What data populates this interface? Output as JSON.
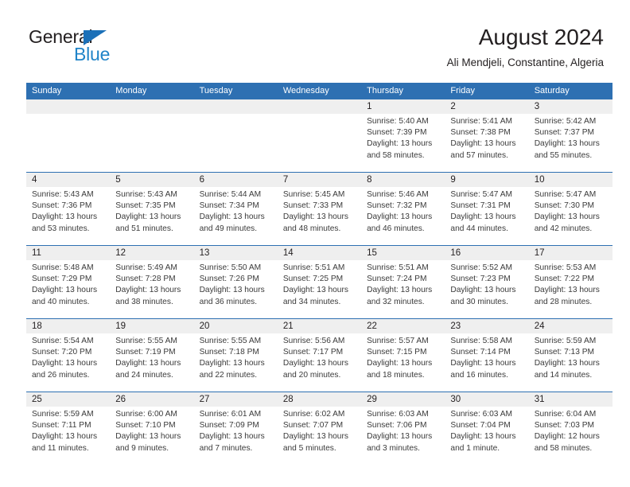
{
  "logo": {
    "word_one": "General",
    "word_two": "Blue",
    "triangle_color": "#1b70b8",
    "blue_color": "#2084c8"
  },
  "header": {
    "title": "August 2024",
    "subtitle": "Ali Mendjeli, Constantine, Algeria"
  },
  "theme": {
    "header_blue": "#2e70b2",
    "day_band_gray": "#efefef",
    "text": "#231f20"
  },
  "calendar": {
    "day_names": [
      "Sunday",
      "Monday",
      "Tuesday",
      "Wednesday",
      "Thursday",
      "Friday",
      "Saturday"
    ],
    "weeks": [
      [
        {
          "day": "",
          "lines": []
        },
        {
          "day": "",
          "lines": []
        },
        {
          "day": "",
          "lines": []
        },
        {
          "day": "",
          "lines": []
        },
        {
          "day": "1",
          "lines": [
            "Sunrise: 5:40 AM",
            "Sunset: 7:39 PM",
            "Daylight: 13 hours",
            "and 58 minutes."
          ]
        },
        {
          "day": "2",
          "lines": [
            "Sunrise: 5:41 AM",
            "Sunset: 7:38 PM",
            "Daylight: 13 hours",
            "and 57 minutes."
          ]
        },
        {
          "day": "3",
          "lines": [
            "Sunrise: 5:42 AM",
            "Sunset: 7:37 PM",
            "Daylight: 13 hours",
            "and 55 minutes."
          ]
        }
      ],
      [
        {
          "day": "4",
          "lines": [
            "Sunrise: 5:43 AM",
            "Sunset: 7:36 PM",
            "Daylight: 13 hours",
            "and 53 minutes."
          ]
        },
        {
          "day": "5",
          "lines": [
            "Sunrise: 5:43 AM",
            "Sunset: 7:35 PM",
            "Daylight: 13 hours",
            "and 51 minutes."
          ]
        },
        {
          "day": "6",
          "lines": [
            "Sunrise: 5:44 AM",
            "Sunset: 7:34 PM",
            "Daylight: 13 hours",
            "and 49 minutes."
          ]
        },
        {
          "day": "7",
          "lines": [
            "Sunrise: 5:45 AM",
            "Sunset: 7:33 PM",
            "Daylight: 13 hours",
            "and 48 minutes."
          ]
        },
        {
          "day": "8",
          "lines": [
            "Sunrise: 5:46 AM",
            "Sunset: 7:32 PM",
            "Daylight: 13 hours",
            "and 46 minutes."
          ]
        },
        {
          "day": "9",
          "lines": [
            "Sunrise: 5:47 AM",
            "Sunset: 7:31 PM",
            "Daylight: 13 hours",
            "and 44 minutes."
          ]
        },
        {
          "day": "10",
          "lines": [
            "Sunrise: 5:47 AM",
            "Sunset: 7:30 PM",
            "Daylight: 13 hours",
            "and 42 minutes."
          ]
        }
      ],
      [
        {
          "day": "11",
          "lines": [
            "Sunrise: 5:48 AM",
            "Sunset: 7:29 PM",
            "Daylight: 13 hours",
            "and 40 minutes."
          ]
        },
        {
          "day": "12",
          "lines": [
            "Sunrise: 5:49 AM",
            "Sunset: 7:28 PM",
            "Daylight: 13 hours",
            "and 38 minutes."
          ]
        },
        {
          "day": "13",
          "lines": [
            "Sunrise: 5:50 AM",
            "Sunset: 7:26 PM",
            "Daylight: 13 hours",
            "and 36 minutes."
          ]
        },
        {
          "day": "14",
          "lines": [
            "Sunrise: 5:51 AM",
            "Sunset: 7:25 PM",
            "Daylight: 13 hours",
            "and 34 minutes."
          ]
        },
        {
          "day": "15",
          "lines": [
            "Sunrise: 5:51 AM",
            "Sunset: 7:24 PM",
            "Daylight: 13 hours",
            "and 32 minutes."
          ]
        },
        {
          "day": "16",
          "lines": [
            "Sunrise: 5:52 AM",
            "Sunset: 7:23 PM",
            "Daylight: 13 hours",
            "and 30 minutes."
          ]
        },
        {
          "day": "17",
          "lines": [
            "Sunrise: 5:53 AM",
            "Sunset: 7:22 PM",
            "Daylight: 13 hours",
            "and 28 minutes."
          ]
        }
      ],
      [
        {
          "day": "18",
          "lines": [
            "Sunrise: 5:54 AM",
            "Sunset: 7:20 PM",
            "Daylight: 13 hours",
            "and 26 minutes."
          ]
        },
        {
          "day": "19",
          "lines": [
            "Sunrise: 5:55 AM",
            "Sunset: 7:19 PM",
            "Daylight: 13 hours",
            "and 24 minutes."
          ]
        },
        {
          "day": "20",
          "lines": [
            "Sunrise: 5:55 AM",
            "Sunset: 7:18 PM",
            "Daylight: 13 hours",
            "and 22 minutes."
          ]
        },
        {
          "day": "21",
          "lines": [
            "Sunrise: 5:56 AM",
            "Sunset: 7:17 PM",
            "Daylight: 13 hours",
            "and 20 minutes."
          ]
        },
        {
          "day": "22",
          "lines": [
            "Sunrise: 5:57 AM",
            "Sunset: 7:15 PM",
            "Daylight: 13 hours",
            "and 18 minutes."
          ]
        },
        {
          "day": "23",
          "lines": [
            "Sunrise: 5:58 AM",
            "Sunset: 7:14 PM",
            "Daylight: 13 hours",
            "and 16 minutes."
          ]
        },
        {
          "day": "24",
          "lines": [
            "Sunrise: 5:59 AM",
            "Sunset: 7:13 PM",
            "Daylight: 13 hours",
            "and 14 minutes."
          ]
        }
      ],
      [
        {
          "day": "25",
          "lines": [
            "Sunrise: 5:59 AM",
            "Sunset: 7:11 PM",
            "Daylight: 13 hours",
            "and 11 minutes."
          ]
        },
        {
          "day": "26",
          "lines": [
            "Sunrise: 6:00 AM",
            "Sunset: 7:10 PM",
            "Daylight: 13 hours",
            "and 9 minutes."
          ]
        },
        {
          "day": "27",
          "lines": [
            "Sunrise: 6:01 AM",
            "Sunset: 7:09 PM",
            "Daylight: 13 hours",
            "and 7 minutes."
          ]
        },
        {
          "day": "28",
          "lines": [
            "Sunrise: 6:02 AM",
            "Sunset: 7:07 PM",
            "Daylight: 13 hours",
            "and 5 minutes."
          ]
        },
        {
          "day": "29",
          "lines": [
            "Sunrise: 6:03 AM",
            "Sunset: 7:06 PM",
            "Daylight: 13 hours",
            "and 3 minutes."
          ]
        },
        {
          "day": "30",
          "lines": [
            "Sunrise: 6:03 AM",
            "Sunset: 7:04 PM",
            "Daylight: 13 hours",
            "and 1 minute."
          ]
        },
        {
          "day": "31",
          "lines": [
            "Sunrise: 6:04 AM",
            "Sunset: 7:03 PM",
            "Daylight: 12 hours",
            "and 58 minutes."
          ]
        }
      ]
    ]
  }
}
